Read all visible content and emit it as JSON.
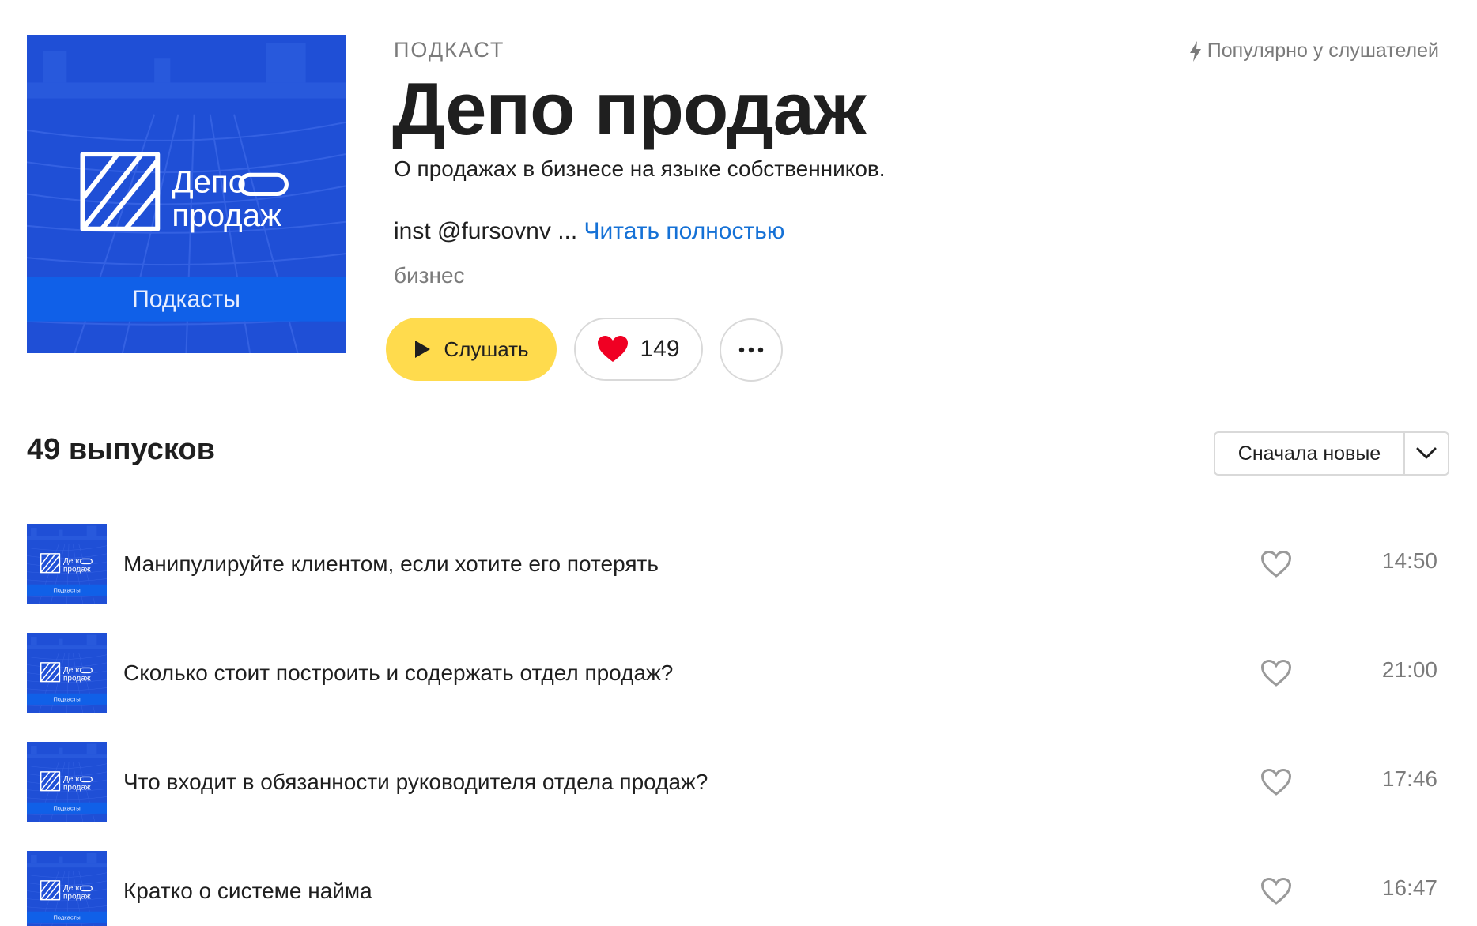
{
  "cover": {
    "logo_line1": "Депо",
    "logo_line2": "продаж",
    "band_label": "Подкасты",
    "colors": {
      "background": "#1f4fd6",
      "band": "#1060e8"
    }
  },
  "header": {
    "type_label": "ПОДКАСТ",
    "popular_label": "Популярно у слушателей",
    "popular_icon": "lightning-icon",
    "title": "Депо продаж",
    "subtitle": "О продажах в бизнесе на языке собственников.",
    "description": "inst @fursovnv ...",
    "read_more": "Читать полностью",
    "genre": "бизнес"
  },
  "actions": {
    "listen_label": "Слушать",
    "listen_icon": "play-icon",
    "like_count": "149",
    "like_icon": "heart-filled-icon",
    "more_icon": "more-dots-icon"
  },
  "episodes_header": {
    "count_label": "49 выпусков",
    "sort_label": "Сначала новые",
    "sort_icon": "chevron-down-icon"
  },
  "episodes": [
    {
      "title": "Манипулируйте клиентом, если хотите его потерять",
      "duration": "14:50"
    },
    {
      "title": "Сколько стоит построить и содержать отдел продаж?",
      "duration": "21:00"
    },
    {
      "title": "Что входит в обязанности руководителя отдела продаж?",
      "duration": "17:46"
    },
    {
      "title": "Кратко о системе найма",
      "duration": "16:47"
    }
  ],
  "colors": {
    "accent_yellow": "#ffdb4d",
    "link_blue": "#1571d6",
    "like_red": "#f00023",
    "muted_text": "#7b7b7b"
  }
}
